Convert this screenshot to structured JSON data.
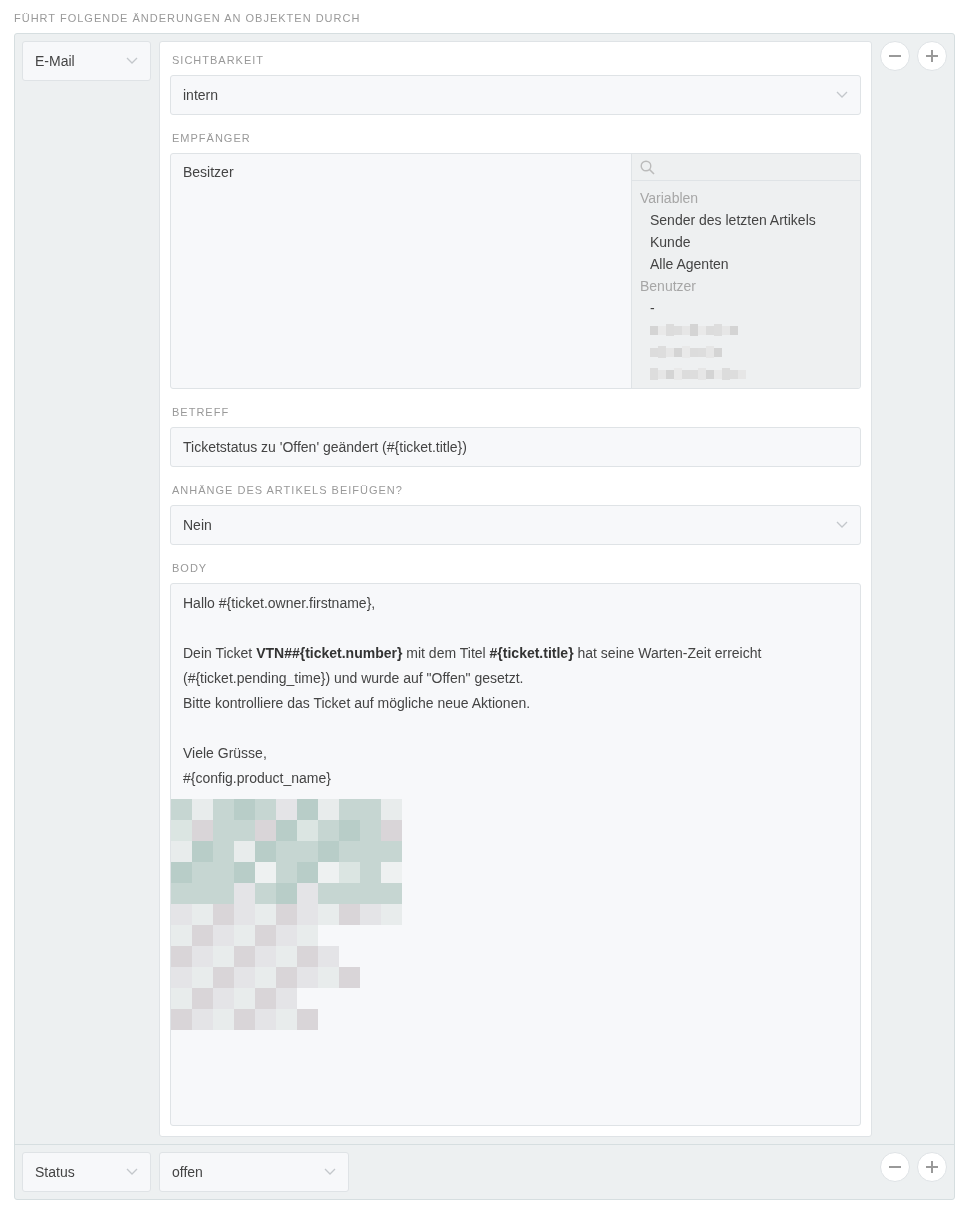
{
  "section_title": "FÜHRT FOLGENDE ÄNDERUNGEN AN OBJEKTEN DURCH",
  "rows": [
    {
      "selects": [
        {
          "value": "E-Mail"
        }
      ],
      "form": {
        "visibility": {
          "label": "SICHTBARKEIT",
          "value": "intern"
        },
        "recipients": {
          "label": "EMPFÄNGER",
          "chosen": [
            "Besitzer"
          ],
          "groups": [
            {
              "title": "Variablen",
              "items": [
                {
                  "kind": "text",
                  "label": "Sender des letzten Artikels"
                },
                {
                  "kind": "text",
                  "label": "Kunde"
                },
                {
                  "kind": "text",
                  "label": "Alle Agenten"
                }
              ]
            },
            {
              "title": "Benutzer",
              "items": [
                {
                  "kind": "text",
                  "label": "-"
                },
                {
                  "kind": "redacted"
                },
                {
                  "kind": "redacted"
                },
                {
                  "kind": "redacted"
                }
              ]
            }
          ]
        },
        "subject": {
          "label": "BETREFF",
          "value": "Ticketstatus zu 'Offen' geändert (#{ticket.title})"
        },
        "attachments": {
          "label": "ANHÄNGE DES ARTIKELS BEIFÜGEN?",
          "value": "Nein"
        },
        "body": {
          "label": "BODY",
          "paragraphs": [
            [
              "Hallo #{ticket.owner.firstname},"
            ],
            [
              "Dein Ticket **VTN##{ticket.number}** mit dem Titel **#{ticket.title}** hat seine Warten-Zeit erreicht",
              "(#{ticket.pending_time}) und wurde auf \"Offen\" gesetzt.",
              "Bitte kontrolliere das Ticket auf mögliche neue Aktionen."
            ],
            [
              "Viele Grüsse,",
              "#{config.product_name}"
            ]
          ],
          "image": {
            "kind": "picture"
          }
        }
      }
    },
    {
      "selects": [
        {
          "value": "Status"
        },
        {
          "value": "offen"
        }
      ]
    }
  ]
}
